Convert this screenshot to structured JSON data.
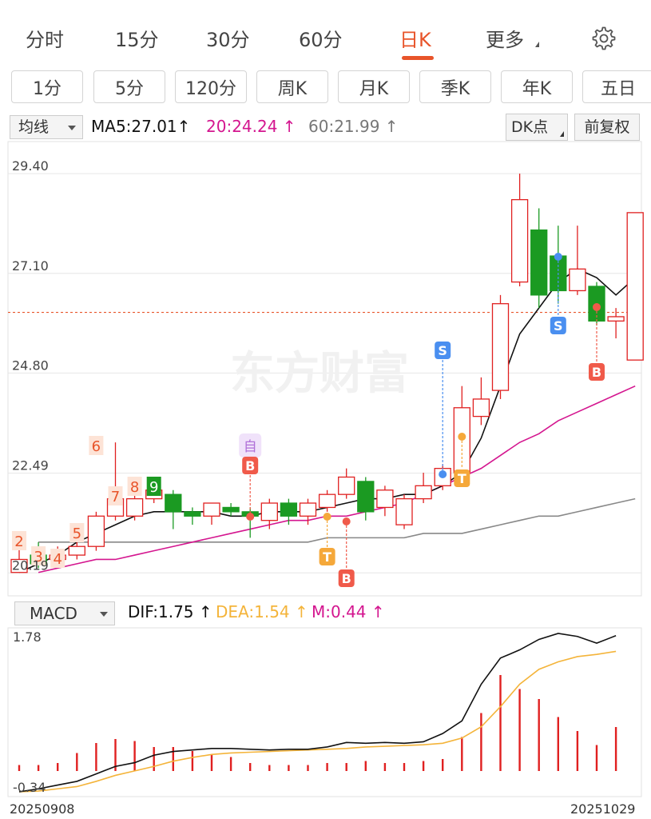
{
  "top_tabs": [
    {
      "label": "分时",
      "active": false
    },
    {
      "label": "15分",
      "active": false
    },
    {
      "label": "30分",
      "active": false
    },
    {
      "label": "60分",
      "active": false
    },
    {
      "label": "日K",
      "active": true
    },
    {
      "label": "更多",
      "active": false
    }
  ],
  "period_buttons": [
    "1分",
    "5分",
    "120分",
    "周K",
    "月K",
    "季K",
    "年K",
    "五日"
  ],
  "ma_bar": {
    "selector": "均线",
    "ma5": "MA5:27.01↑",
    "ma20": "20:24.24 ↑",
    "ma60": "60:21.99 ↑",
    "dk_button": "DK点",
    "fq_button": "前复权"
  },
  "price_axis": {
    "labels": [
      "29.40",
      "27.10",
      "24.80",
      "22.49",
      "20.19"
    ],
    "current_price_line": 26.2
  },
  "watermark": "东方财富",
  "td_markers": [
    "2",
    "3",
    "4",
    "5",
    "6",
    "7",
    "8",
    "9"
  ],
  "signals": {
    "buy": "B",
    "sell": "S",
    "turn": "T",
    "auto": "自"
  },
  "macd_bar": {
    "selector": "MACD",
    "dif": "DIF:1.75 ↑",
    "dea": "DEA:1.54 ↑",
    "m": "M:0.44 ↑"
  },
  "macd_axis": {
    "top": "1.78",
    "bottom": "-0.34"
  },
  "dates": {
    "start": "20250908",
    "end": "20251029"
  },
  "colors": {
    "accent": "#e8542a",
    "up": "#e02020",
    "down": "#1b9a22",
    "ma5": "#111111",
    "ma20": "#d4168f",
    "ma60": "#888888",
    "dea": "#f4b43a",
    "buy": "#f05a4a",
    "sell": "#4a8ff0",
    "turn": "#f5a83a",
    "auto": "#b070d8"
  },
  "chart_data": {
    "type": "candlestick",
    "y_range": [
      19.9,
      29.9
    ],
    "candles": [
      {
        "o": 20.2,
        "c": 20.5,
        "h": 20.8,
        "l": 20.2
      },
      {
        "o": 20.6,
        "c": 20.4,
        "h": 20.9,
        "l": 20.3
      },
      {
        "o": 20.5,
        "c": 20.6,
        "h": 20.8,
        "l": 20.4
      },
      {
        "o": 20.6,
        "c": 20.8,
        "h": 20.9,
        "l": 20.5
      },
      {
        "o": 20.8,
        "c": 21.5,
        "h": 21.6,
        "l": 20.7
      },
      {
        "o": 21.5,
        "c": 21.9,
        "h": 23.2,
        "l": 21.4
      },
      {
        "o": 21.5,
        "c": 21.9,
        "h": 22.0,
        "l": 21.4
      },
      {
        "o": 21.9,
        "c": 22.1,
        "h": 22.3,
        "l": 21.8
      },
      {
        "o": 22.0,
        "c": 21.6,
        "h": 22.1,
        "l": 21.2
      },
      {
        "o": 21.6,
        "c": 21.5,
        "h": 21.7,
        "l": 21.3
      },
      {
        "o": 21.5,
        "c": 21.8,
        "h": 21.8,
        "l": 21.3
      },
      {
        "o": 21.7,
        "c": 21.6,
        "h": 21.8,
        "l": 21.5
      },
      {
        "o": 21.6,
        "c": 21.5,
        "h": 21.7,
        "l": 21.0
      },
      {
        "o": 21.4,
        "c": 21.8,
        "h": 21.9,
        "l": 21.2
      },
      {
        "o": 21.8,
        "c": 21.5,
        "h": 21.9,
        "l": 21.3
      },
      {
        "o": 21.5,
        "c": 21.8,
        "h": 21.9,
        "l": 21.3
      },
      {
        "o": 21.7,
        "c": 22.0,
        "h": 22.1,
        "l": 21.6
      },
      {
        "o": 22.0,
        "c": 22.4,
        "h": 22.6,
        "l": 21.9
      },
      {
        "o": 22.3,
        "c": 21.6,
        "h": 22.4,
        "l": 21.4
      },
      {
        "o": 21.7,
        "c": 22.1,
        "h": 22.2,
        "l": 21.5
      },
      {
        "o": 21.3,
        "c": 21.9,
        "h": 22.0,
        "l": 21.2
      },
      {
        "o": 21.9,
        "c": 22.2,
        "h": 22.5,
        "l": 21.8
      },
      {
        "o": 22.2,
        "c": 22.6,
        "h": 22.7,
        "l": 22.1
      },
      {
        "o": 22.5,
        "c": 24.0,
        "h": 24.5,
        "l": 22.4
      },
      {
        "o": 23.8,
        "c": 24.2,
        "h": 24.7,
        "l": 23.6
      },
      {
        "o": 24.4,
        "c": 26.4,
        "h": 26.6,
        "l": 24.2
      },
      {
        "o": 26.9,
        "c": 28.8,
        "h": 29.4,
        "l": 26.8
      },
      {
        "o": 28.1,
        "c": 26.6,
        "h": 28.6,
        "l": 26.3
      },
      {
        "o": 27.5,
        "c": 26.7,
        "h": 28.2,
        "l": 26.4
      },
      {
        "o": 26.7,
        "c": 27.2,
        "h": 28.2,
        "l": 26.6
      },
      {
        "o": 26.8,
        "c": 26.0,
        "h": 26.9,
        "l": 25.9
      },
      {
        "o": 26.0,
        "c": 26.1,
        "h": 26.3,
        "l": 25.6
      },
      {
        "o": 25.1,
        "c": 28.5,
        "h": 28.5,
        "l": 25.1
      }
    ],
    "ma5": [
      20.2,
      20.4,
      20.6,
      20.9,
      21.1,
      21.3,
      21.5,
      21.6,
      21.6,
      21.6,
      21.6,
      21.5,
      21.5,
      21.6,
      21.6,
      21.6,
      21.7,
      21.8,
      21.9,
      21.9,
      22.0,
      22.0,
      22.2,
      22.5,
      23.3,
      24.5,
      25.7,
      26.3,
      26.9,
      27.2,
      27.0,
      26.6,
      27.0
    ],
    "ma20": [
      20.2,
      20.3,
      20.4,
      20.5,
      20.5,
      20.6,
      20.7,
      20.8,
      20.9,
      21.0,
      21.1,
      21.2,
      21.3,
      21.4,
      21.4,
      21.5,
      21.5,
      21.6,
      21.7,
      21.8,
      22.0,
      22.2,
      22.4,
      22.6,
      22.9,
      23.2,
      23.4,
      23.7,
      23.9,
      24.1,
      24.3,
      24.5
    ],
    "ma60": [
      20.9,
      20.9,
      20.9,
      20.9,
      20.9,
      20.9,
      20.9,
      20.9,
      20.9,
      20.9,
      20.9,
      20.9,
      20.9,
      20.9,
      20.9,
      21.0,
      21.0,
      21.0,
      21.0,
      21.0,
      21.1,
      21.1,
      21.1,
      21.2,
      21.3,
      21.4,
      21.5,
      21.5,
      21.6,
      21.7,
      21.8,
      21.9
    ],
    "macd": {
      "y_range": [
        -0.34,
        1.78
      ],
      "dif": [
        -0.34,
        -0.3,
        -0.25,
        -0.2,
        -0.1,
        0.0,
        0.05,
        0.15,
        0.2,
        0.22,
        0.24,
        0.24,
        0.23,
        0.22,
        0.23,
        0.23,
        0.26,
        0.32,
        0.31,
        0.32,
        0.31,
        0.33,
        0.44,
        0.61,
        1.1,
        1.45,
        1.56,
        1.7,
        1.78,
        1.74,
        1.65,
        1.75
      ],
      "dea": [
        -0.34,
        -0.33,
        -0.3,
        -0.27,
        -0.2,
        -0.12,
        -0.06,
        0.0,
        0.07,
        0.12,
        0.16,
        0.18,
        0.19,
        0.2,
        0.21,
        0.22,
        0.23,
        0.24,
        0.26,
        0.27,
        0.28,
        0.29,
        0.31,
        0.38,
        0.53,
        0.8,
        1.1,
        1.3,
        1.4,
        1.47,
        1.5,
        1.54
      ],
      "m": [
        0.06,
        0.06,
        0.08,
        0.18,
        0.28,
        0.32,
        0.3,
        0.24,
        0.24,
        0.2,
        0.16,
        0.14,
        0.08,
        0.06,
        0.06,
        0.06,
        0.08,
        0.08,
        0.1,
        0.08,
        0.08,
        0.1,
        0.12,
        0.34,
        0.58,
        0.96,
        0.82,
        0.72,
        0.54,
        0.4,
        0.26,
        0.44
      ]
    }
  }
}
